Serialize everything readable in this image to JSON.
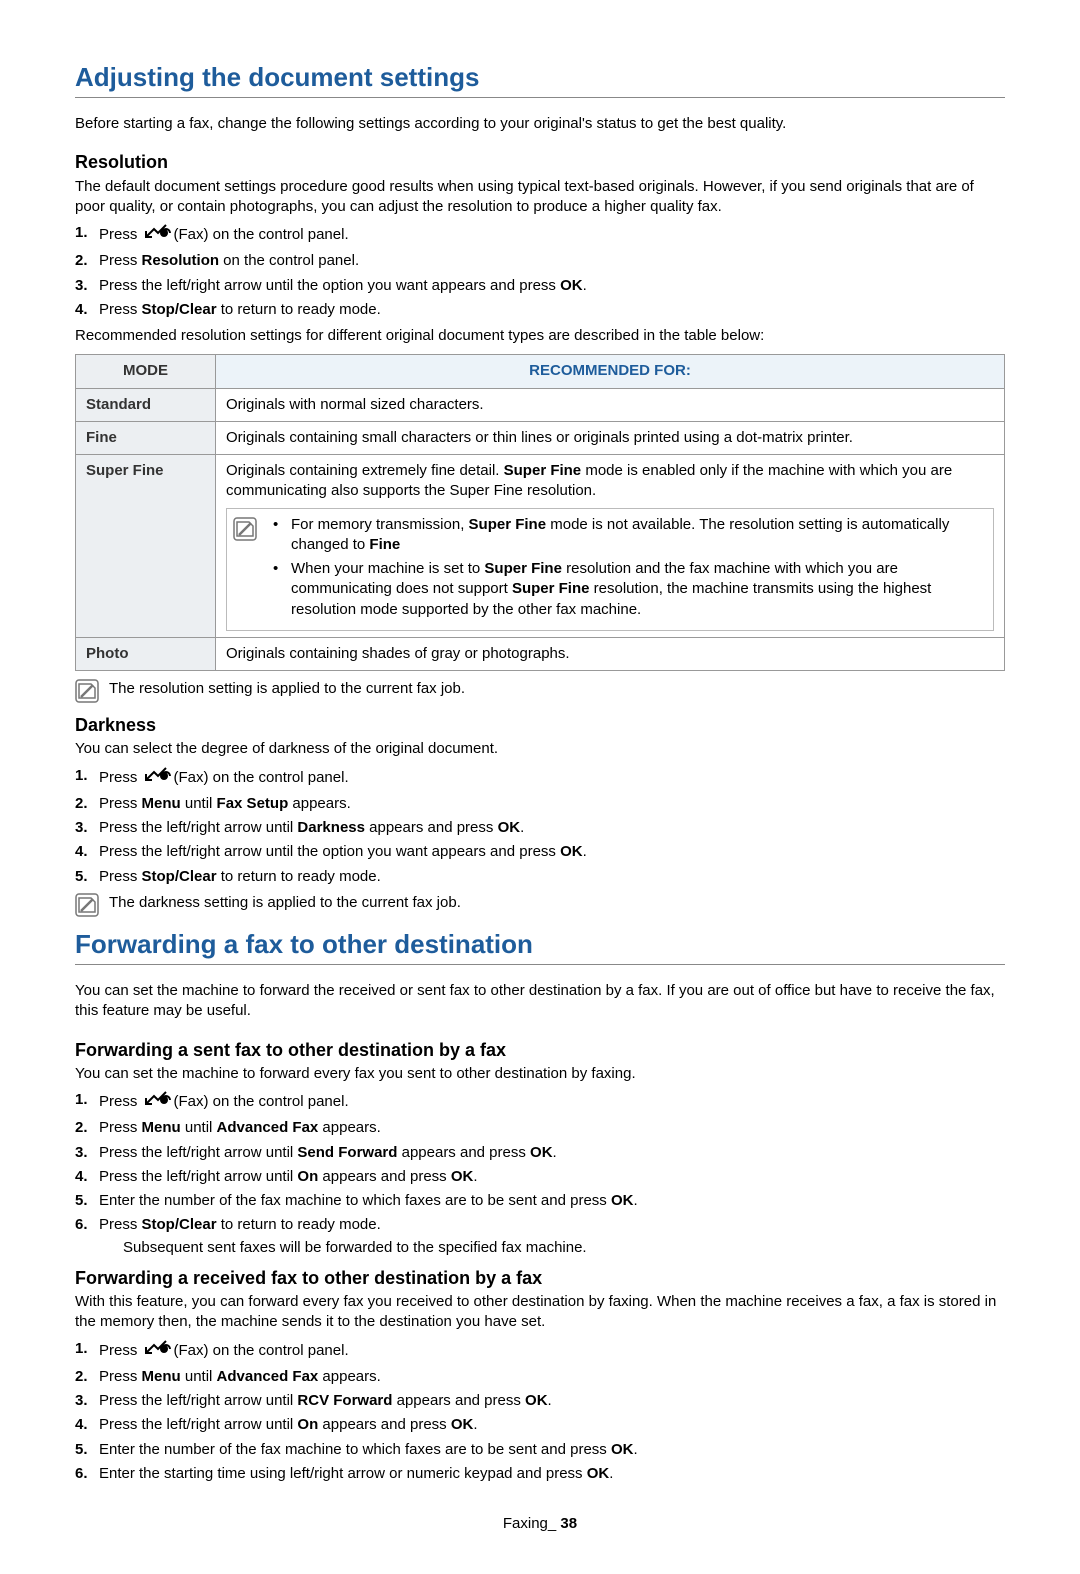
{
  "section1": {
    "title": "Adjusting the document settings",
    "intro": "Before starting a fax, change the following settings according to your original's status to get the best quality.",
    "resolution": {
      "heading": "Resolution",
      "desc": "The default document settings procedure good results when using typical text-based originals. However, if you send originals that are of poor quality, or contain photographs, you can adjust the resolution to produce a higher quality fax.",
      "steps": {
        "s1a": "Press ",
        "s1b": "(Fax) on the control panel.",
        "s2a": "Press ",
        "s2b": "Resolution",
        "s2c": " on the control panel.",
        "s3a": "Press the left/right arrow until the option you want appears and press ",
        "s3b": "OK",
        "s3c": ".",
        "s4a": "Press ",
        "s4b": "Stop/Clear",
        "s4c": " to return to ready mode."
      },
      "rec_line": "Recommended resolution settings for different original document types are described in the table below:",
      "table": {
        "h1": "MODE",
        "h2": "RECOMMENDED FOR:",
        "r1m": "Standard",
        "r1d": "Originals with normal sized characters.",
        "r2m": "Fine",
        "r2d": "Originals containing small characters or thin lines or originals printed using a dot-matrix printer.",
        "r3m": "Super Fine",
        "r3d_a": "Originals containing extremely fine detail. ",
        "r3d_b": "Super Fine",
        "r3d_c": " mode is enabled only if the machine with which you are communicating also supports the Super Fine resolution.",
        "r3n1_a": "For memory transmission, ",
        "r3n1_b": "Super Fine",
        "r3n1_c": " mode is not available. The resolution setting is automatically changed to ",
        "r3n1_d": "Fine",
        "r3n2_a": "When your machine is set to ",
        "r3n2_b": "Super Fine",
        "r3n2_c": " resolution and the fax machine with which you are communicating does not support ",
        "r3n2_d": "Super Fine",
        "r3n2_e": " resolution, the machine transmits using the highest resolution mode supported by the other fax machine.",
        "r4m": "Photo",
        "r4d": "Originals containing shades of gray or photographs."
      },
      "note": "The resolution setting is applied to the current fax job."
    },
    "darkness": {
      "heading": "Darkness",
      "desc": "You can select the degree of darkness of the original document.",
      "steps": {
        "s1a": "Press ",
        "s1b": "(Fax) on the control panel.",
        "s2a": "Press ",
        "s2b": "Menu",
        "s2c": " until ",
        "s2d": "Fax Setup",
        "s2e": " appears.",
        "s3a": "Press the left/right arrow until ",
        "s3b": "Darkness",
        "s3c": " appears and press ",
        "s3d": "OK",
        "s3e": ".",
        "s4a": "Press the left/right arrow until the option you want appears and press ",
        "s4b": "OK",
        "s4c": ".",
        "s5a": "Press ",
        "s5b": "Stop/Clear",
        "s5c": " to return to ready mode."
      },
      "note": "The darkness setting is applied to the current fax job."
    }
  },
  "section2": {
    "title": "Forwarding a fax to other destination",
    "intro": "You can set the machine to forward the received or sent fax to other destination by a fax. If you are out of office but have to receive the fax, this feature may be useful.",
    "sent": {
      "heading": "Forwarding a sent fax to other destination by a fax",
      "desc": "You can set the machine to forward every fax you sent to other destination by faxing.",
      "steps": {
        "s1a": "Press ",
        "s1b": "(Fax) on the control panel.",
        "s2a": "Press ",
        "s2b": "Menu",
        "s2c": " until ",
        "s2d": "Advanced Fax",
        "s2e": " appears.",
        "s3a": "Press the left/right arrow until ",
        "s3b": "Send Forward",
        "s3c": " appears and press ",
        "s3d": "OK",
        "s3e": ".",
        "s4a": "Press the left/right arrow until ",
        "s4b": "On",
        "s4c": " appears and press ",
        "s4d": "OK",
        "s4e": ".",
        "s5a": "Enter the number of the fax machine to which faxes are to be sent and press ",
        "s5b": "OK",
        "s5c": ".",
        "s6a": "Press ",
        "s6b": "Stop/Clear",
        "s6c": " to return to ready mode.",
        "s6sub": "Subsequent sent faxes will be forwarded to the specified fax machine."
      }
    },
    "rcv": {
      "heading": "Forwarding a received fax to other destination by a fax",
      "desc": "With this feature, you can forward every fax you received to other destination by faxing. When the machine receives a fax, a fax is stored in the memory then, the machine sends it to the destination you have set.",
      "steps": {
        "s1a": "Press ",
        "s1b": "(Fax) on the control panel.",
        "s2a": "Press ",
        "s2b": "Menu",
        "s2c": " until ",
        "s2d": "Advanced Fax",
        "s2e": " appears.",
        "s3a": "Press the left/right arrow until ",
        "s3b": "RCV Forward",
        "s3c": " appears and press ",
        "s3d": "OK",
        "s3e": ".",
        "s4a": "Press the left/right arrow until ",
        "s4b": "On",
        "s4c": " appears and press ",
        "s4d": "OK",
        "s4e": ".",
        "s5a": "Enter the number of the fax machine to which faxes are to be sent and press ",
        "s5b": "OK",
        "s5c": ".",
        "s6a": "Enter the starting time using left/right arrow or numeric keypad and press ",
        "s6b": "OK",
        "s6c": "."
      }
    }
  },
  "footer": {
    "label": "Faxing_ ",
    "page": "38"
  }
}
